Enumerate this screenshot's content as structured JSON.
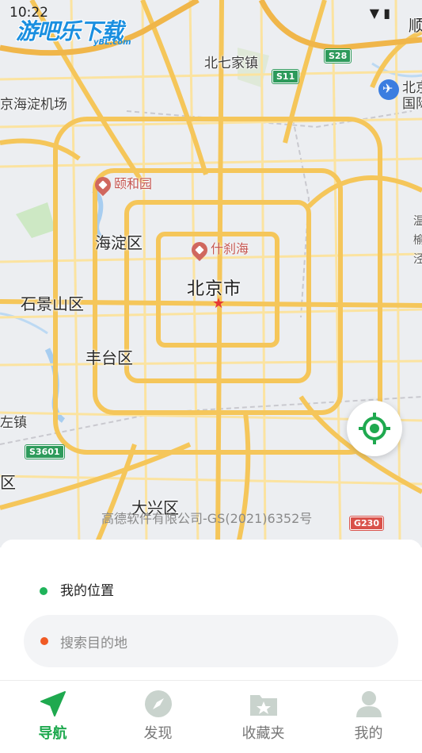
{
  "status_bar": {
    "time": "10:22",
    "icons": "▼ ▮"
  },
  "watermark": {
    "text": "游吧乐下载",
    "sub": "yBL.com"
  },
  "map": {
    "labels": {
      "beiqijia": "北七家镇",
      "airport_left": "京海淀机场",
      "airport_right_1": "北京",
      "airport_right_2": "国际",
      "shun": "顺",
      "haidian": "海淀区",
      "beijing": "北京市",
      "shijingshan": "石景山区",
      "fengtai": "丰台区",
      "daxing": "大兴区",
      "zuo_zhen": "左镇",
      "qu": "区",
      "edge_r1": "温",
      "edge_r2": "榆",
      "edge_r3": "泾"
    },
    "pois": {
      "yiheyuan": "颐和园",
      "shichahai": "什刹海"
    },
    "road_badges": {
      "s28": "S28",
      "s11": "S11",
      "s3601": "S3601",
      "g230": "G230"
    },
    "copyright": "高德软件有限公司-GS(2021)6352号"
  },
  "panel": {
    "my_location": "我的位置",
    "search_placeholder": "搜索目的地"
  },
  "tabs": [
    {
      "label": "导航",
      "icon": "navigation-arrow-icon",
      "active": true
    },
    {
      "label": "发现",
      "icon": "compass-icon",
      "active": false
    },
    {
      "label": "收藏夹",
      "icon": "favorites-folder-icon",
      "active": false
    },
    {
      "label": "我的",
      "icon": "user-profile-icon",
      "active": false
    }
  ],
  "colors": {
    "accent": "#1fa94f",
    "road_major": "#f5c65a",
    "road_minor": "#fbe3a0",
    "water": "#a7cdf0",
    "green": "#cde8c4"
  }
}
